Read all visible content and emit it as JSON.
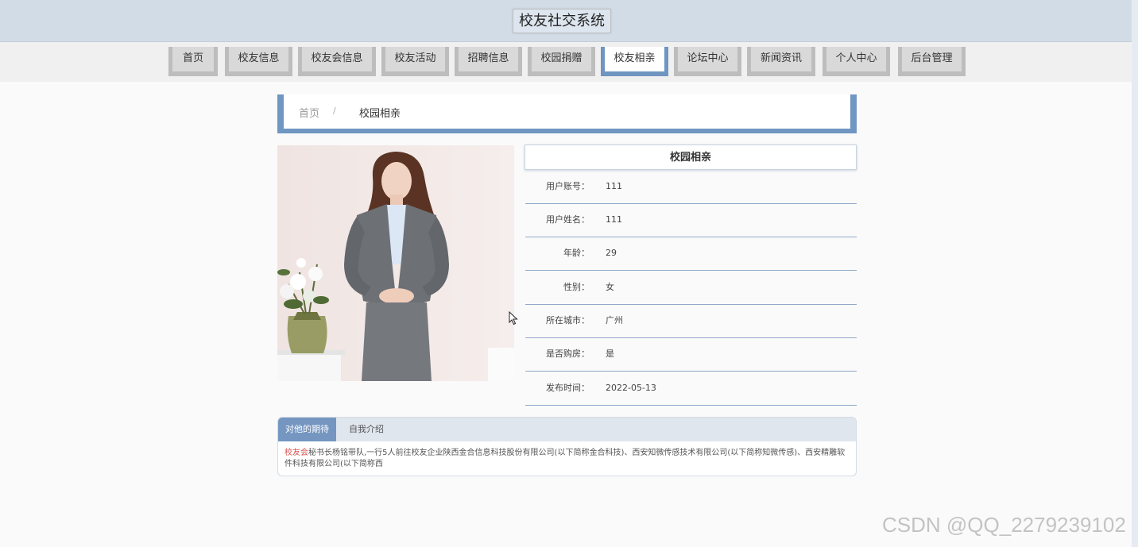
{
  "header": {
    "title": "校友社交系统"
  },
  "nav": {
    "items": [
      {
        "label": "首页"
      },
      {
        "label": "校友信息"
      },
      {
        "label": "校友会信息"
      },
      {
        "label": "校友活动"
      },
      {
        "label": "招聘信息"
      },
      {
        "label": "校园捐赠"
      },
      {
        "label": "校友相亲",
        "active": true
      },
      {
        "label": "论坛中心"
      },
      {
        "label": "新闻资讯"
      },
      {
        "label": "个人中心"
      },
      {
        "label": "后台管理"
      }
    ]
  },
  "breadcrumb": {
    "home": "首页",
    "separator": "/",
    "current": "校园相亲"
  },
  "detail": {
    "title": "校园相亲",
    "fields": [
      {
        "label": "用户账号：",
        "value": "111"
      },
      {
        "label": "用户姓名：",
        "value": "111"
      },
      {
        "label": "年龄：",
        "value": "29"
      },
      {
        "label": "性别：",
        "value": "女"
      },
      {
        "label": "所在城市：",
        "value": "广州"
      },
      {
        "label": "是否购房：",
        "value": "是"
      },
      {
        "label": "发布时间：",
        "value": "2022-05-13"
      }
    ]
  },
  "tabs": {
    "items": [
      {
        "label": "对他的期待",
        "active": true
      },
      {
        "label": "自我介绍"
      }
    ],
    "content_highlight": "校友会",
    "content_text": "秘书长杨铭带队,一行5人前往校友企业陕西金合信息科技股份有限公司(以下简称金合科技)、西安知微传感技术有限公司(以下简称知微传感)、西安精雕软件科技有限公司(以下简称西"
  },
  "watermark": "CSDN @QQ_2279239102",
  "colors": {
    "accent": "#7096c2",
    "header_bg": "#d2dce7"
  }
}
